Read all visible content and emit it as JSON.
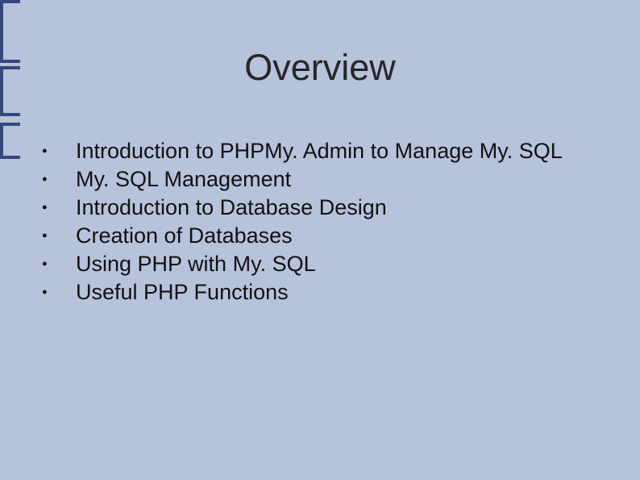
{
  "slide": {
    "title": "Overview",
    "bullets": [
      "Introduction to PHPMy. Admin to Manage My. SQL",
      "My. SQL Management",
      "Introduction to Database Design",
      "Creation of Databases",
      "Using PHP with My. SQL",
      "Useful PHP Functions"
    ]
  }
}
